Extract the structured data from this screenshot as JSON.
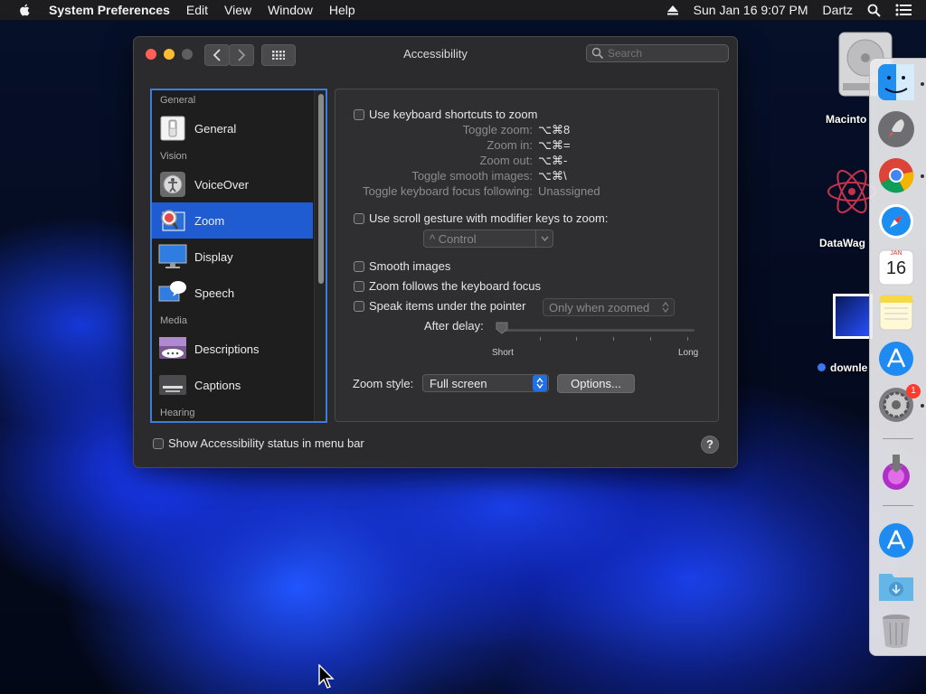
{
  "menubar": {
    "app_name": "System Preferences",
    "menus": [
      "Edit",
      "View",
      "Window",
      "Help"
    ],
    "datetime": "Sun Jan 16  9:07 PM",
    "user": "Dartz"
  },
  "window": {
    "title": "Accessibility",
    "search_placeholder": "Search"
  },
  "sidebar": {
    "sections": {
      "general": "General",
      "vision": "Vision",
      "media": "Media",
      "hearing": "Hearing"
    },
    "items": {
      "general": "General",
      "voiceover": "VoiceOver",
      "zoom": "Zoom",
      "display": "Display",
      "speech": "Speech",
      "descriptions": "Descriptions",
      "captions": "Captions"
    },
    "selected": "Zoom"
  },
  "zoom": {
    "keyboard_shortcuts_label": "Use keyboard shortcuts to zoom",
    "shortcuts": [
      {
        "label": "Toggle zoom:",
        "key": "⌥⌘8"
      },
      {
        "label": "Zoom in:",
        "key": "⌥⌘="
      },
      {
        "label": "Zoom out:",
        "key": "⌥⌘-"
      },
      {
        "label": "Toggle smooth images:",
        "key": "⌥⌘\\"
      },
      {
        "label": "Toggle keyboard focus following:",
        "key": "Unassigned"
      }
    ],
    "scroll_gesture_label": "Use scroll gesture with modifier keys to zoom:",
    "modifier_value": "^ Control",
    "smooth_images_label": "Smooth images",
    "follow_focus_label": "Zoom follows the keyboard focus",
    "speak_items_label": "Speak items under the pointer",
    "speak_items_value": "Only when zoomed",
    "after_delay_label": "After delay:",
    "slider_min": "Short",
    "slider_max": "Long",
    "zoom_style_label": "Zoom style:",
    "zoom_style_value": "Full screen",
    "options_label": "Options..."
  },
  "footer": {
    "status_menu_label": "Show Accessibility status in menu bar",
    "help_label": "?"
  },
  "desktop": {
    "icons": [
      "Macinto",
      "DataWag",
      "downle"
    ]
  },
  "dock": {
    "calendar_month": "JAN",
    "calendar_day": "16",
    "settings_badge": "1"
  }
}
